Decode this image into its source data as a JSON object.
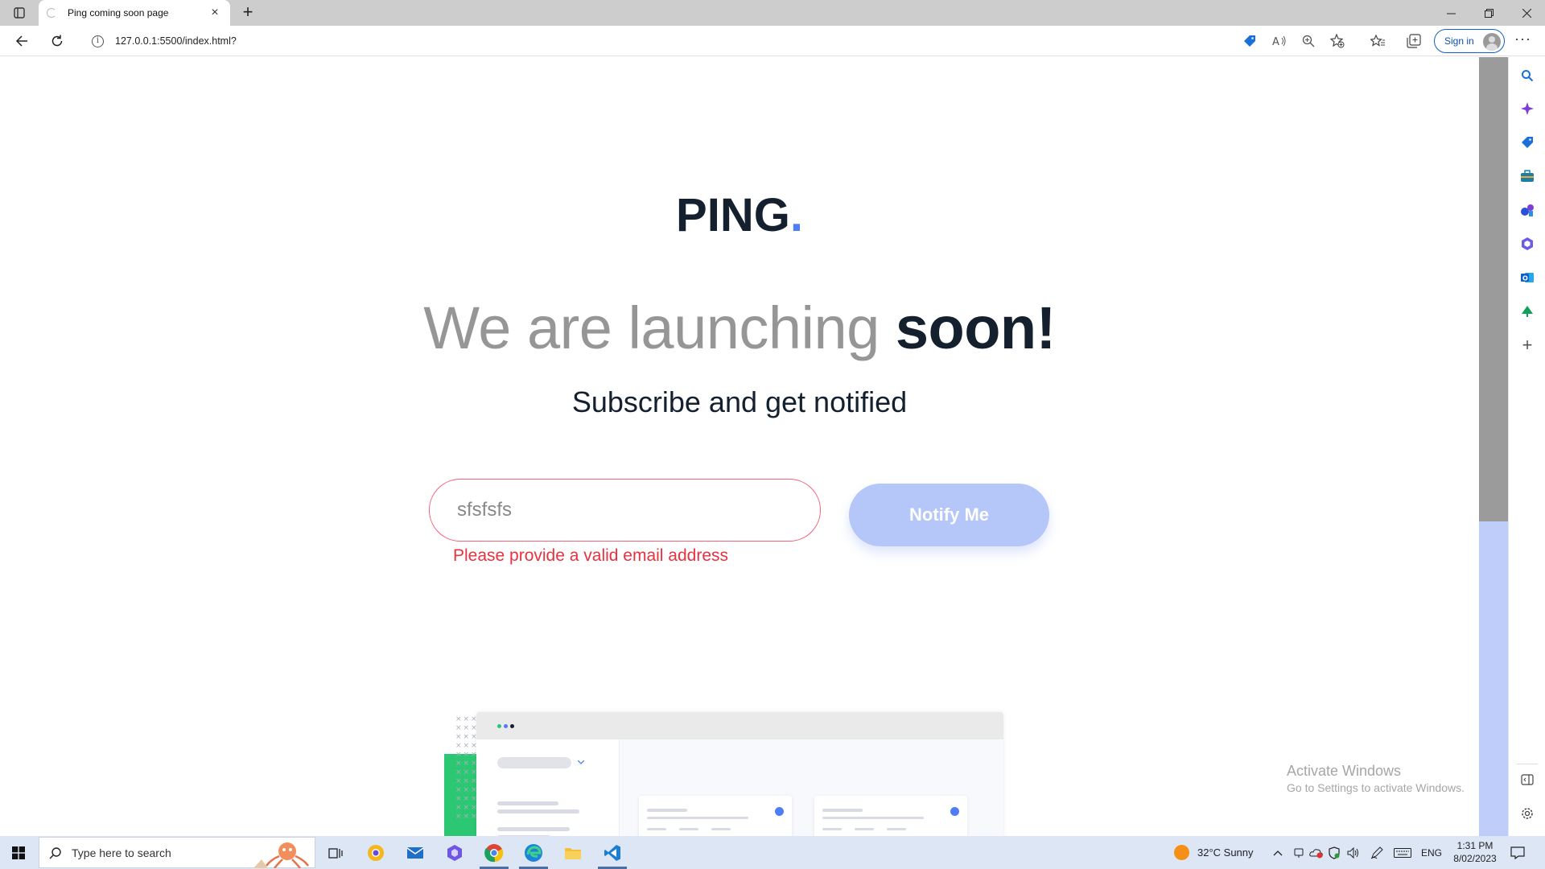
{
  "browser": {
    "tab_title": "Ping coming soon page",
    "tab_close": "×",
    "new_tab": "+",
    "url": "127.0.0.1:5500/index.html?",
    "signin_label": "Sign in",
    "more": "···"
  },
  "page": {
    "logo_text": "PING",
    "logo_dot": ".",
    "headline_light": "We are launching",
    "headline_bold": "soon!",
    "subtitle": "Subscribe and get notified",
    "email_value": "sfsfsfs",
    "error_text": "Please provide a valid email address",
    "notify_label": "Notify Me"
  },
  "watermark": {
    "line1": "Activate Windows",
    "line2": "Go to Settings to activate Windows."
  },
  "taskbar": {
    "search_placeholder": "Type here to search",
    "weather": "32°C  Sunny",
    "lang": "ENG",
    "time": "1:31 PM",
    "date": "8/02/2023"
  },
  "colors": {
    "accent": "#4d7ef5",
    "dark_text": "#15202f",
    "error": "#e8323f",
    "button_disabled": "#b5c6f9",
    "green": "#2cc773"
  }
}
